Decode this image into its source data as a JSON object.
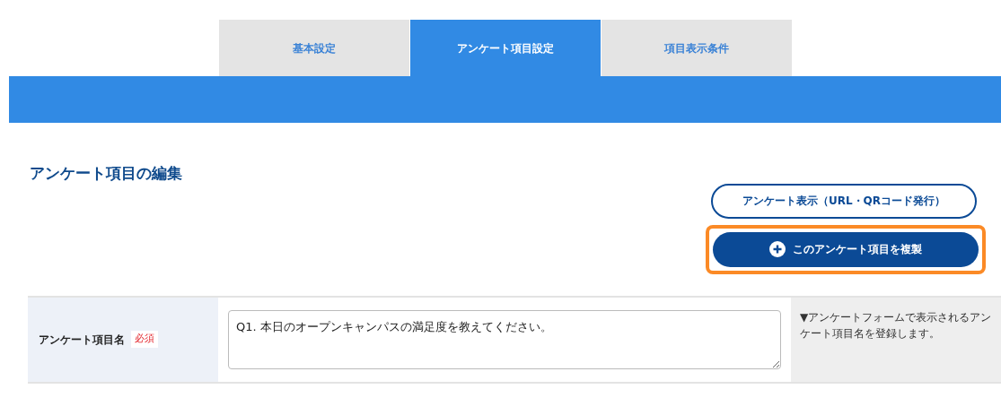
{
  "tabs": [
    {
      "label": "基本設定",
      "selected": false
    },
    {
      "label": "アンケート項目設定",
      "selected": true
    },
    {
      "label": "項目表示条件",
      "selected": false
    }
  ],
  "section_title": "アンケート項目の編集",
  "actions": [
    {
      "kind": "outline",
      "label": "アンケート表示（URL・QRコード発行）",
      "highlighted": false
    },
    {
      "kind": "primary",
      "label": "このアンケート項目を複製",
      "highlighted": true
    }
  ],
  "form_rows": [
    {
      "label": "アンケート項目名",
      "required_badge": "必須",
      "value": "Q1. 本日のオープンキャンパスの満足度を教えてください。",
      "hint": "▼アンケートフォームで表示されるアンケート項目名を登録します。"
    }
  ]
}
